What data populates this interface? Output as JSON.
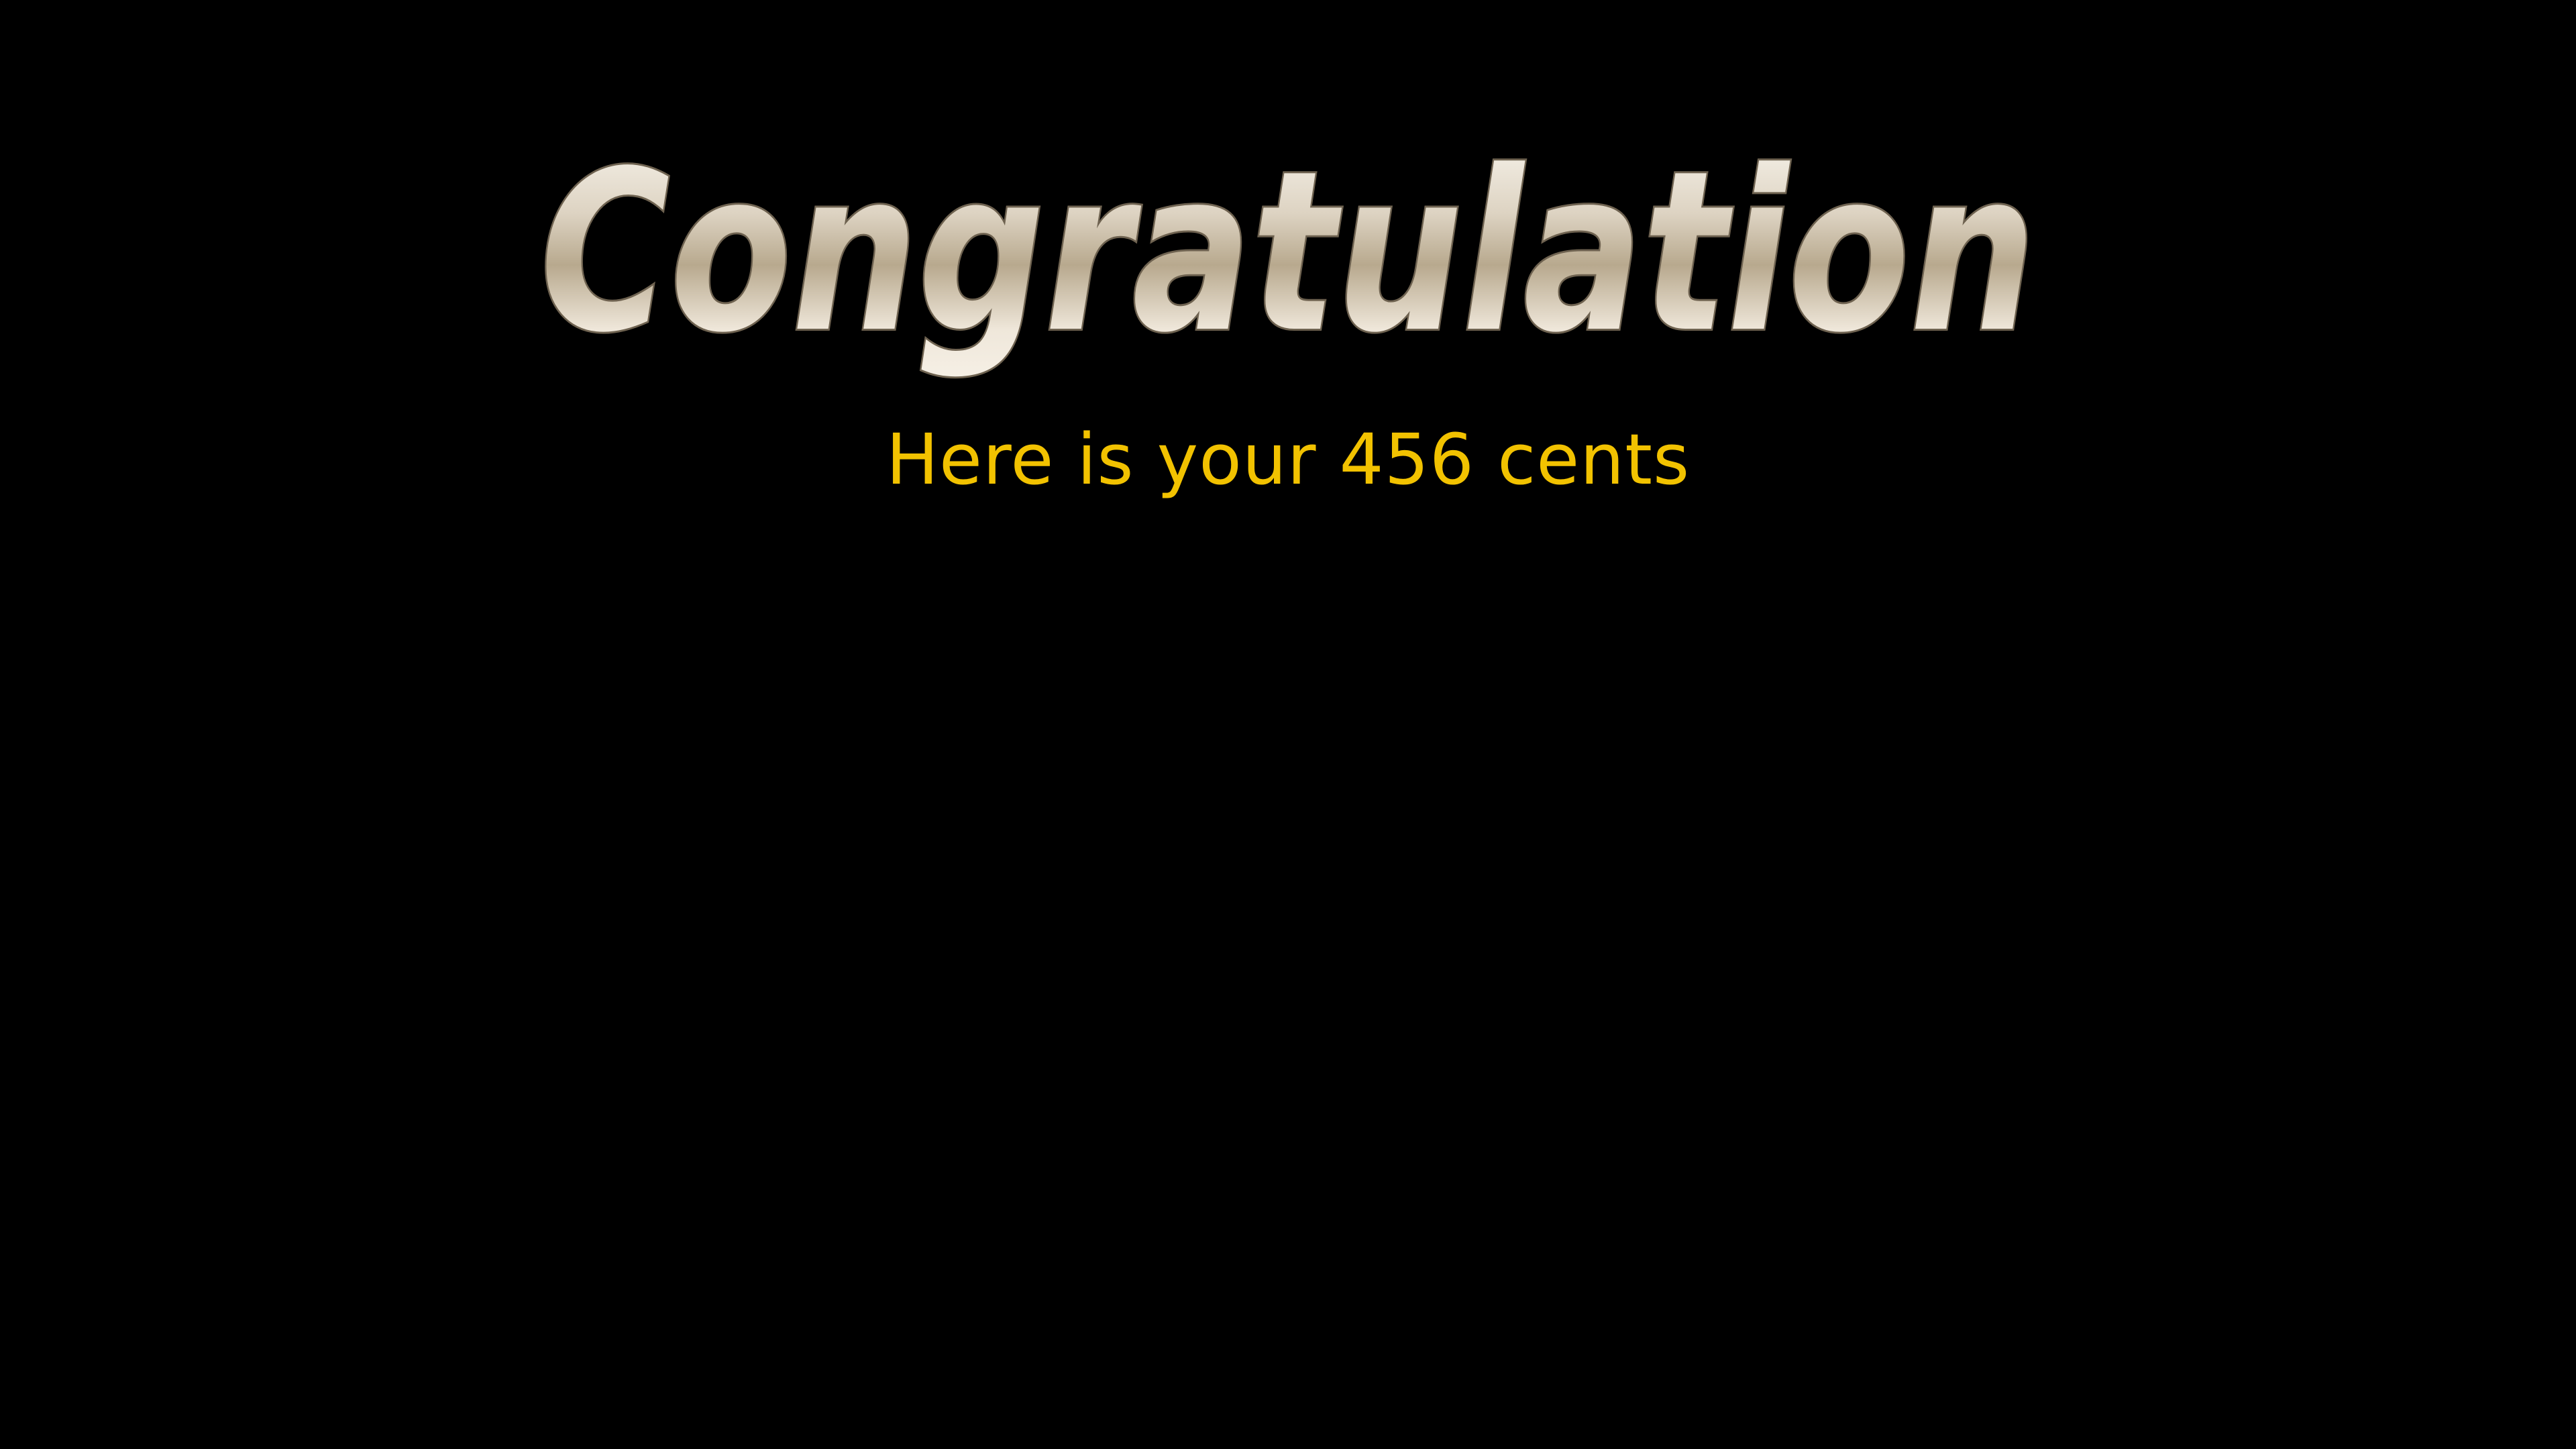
{
  "screen": {
    "title": "Congratulation",
    "message": "Here is your 456 cents"
  },
  "colors": {
    "background": "#000000",
    "message_text": "#f2c200",
    "title_gradient_top": "#fbf8f1",
    "title_gradient_mid": "#b8a98e",
    "title_gradient_bottom": "#f6f0e6",
    "title_outline": "#6e6250"
  }
}
